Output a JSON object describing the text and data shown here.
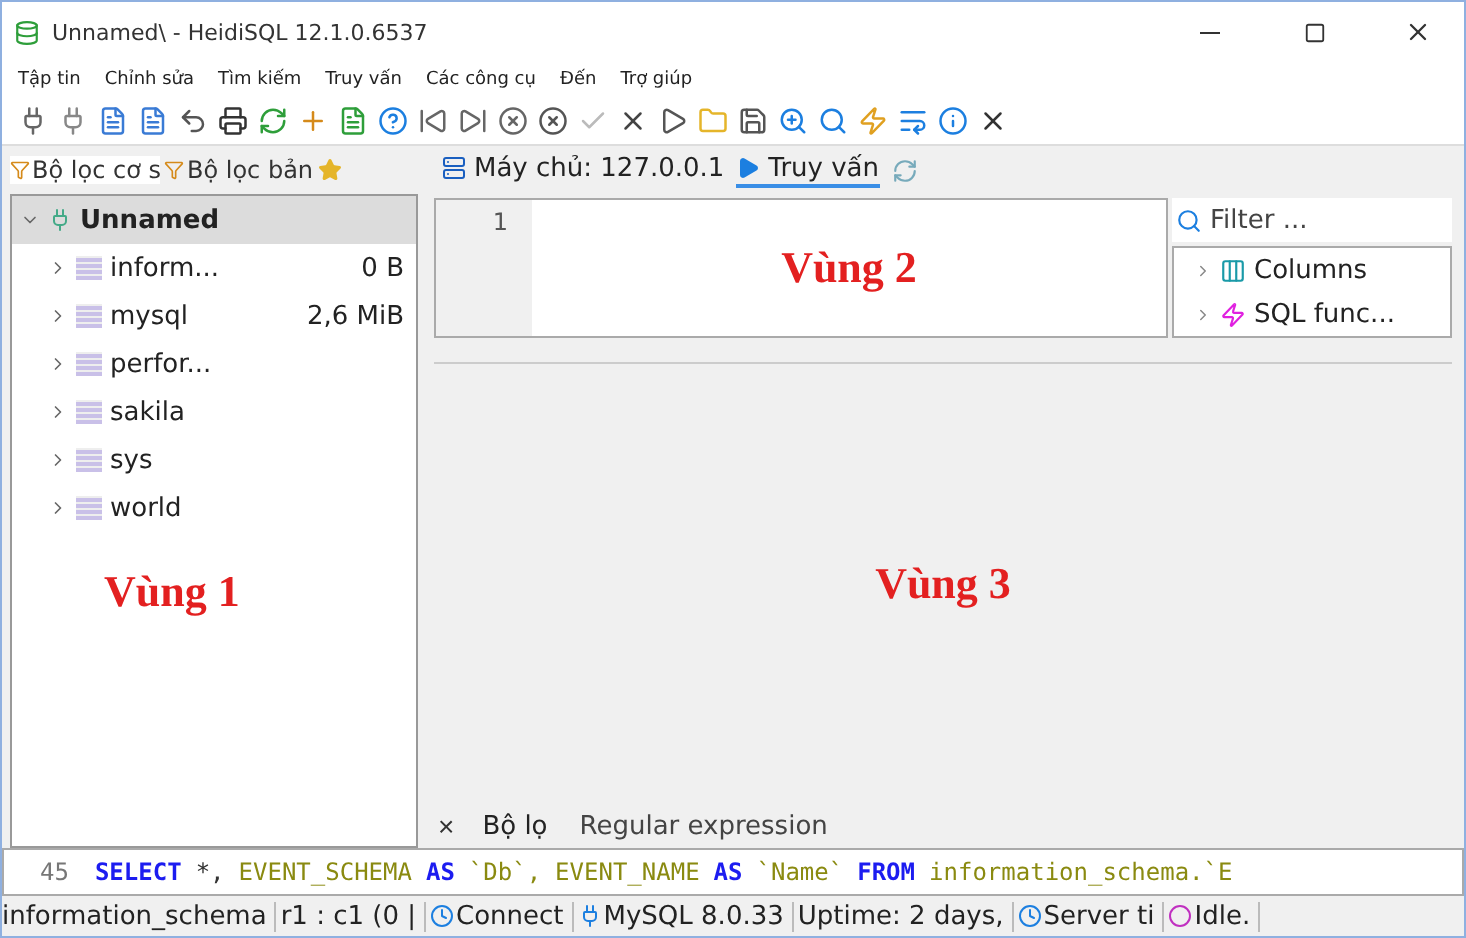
{
  "window": {
    "title": "Unnamed\\ - HeidiSQL 12.1.0.6537"
  },
  "menu": [
    "Tập tin",
    "Chỉnh sửa",
    "Tìm kiếm",
    "Truy vấn",
    "Các công cụ",
    "Đến",
    "Trợ giúp"
  ],
  "left_tabs": [
    {
      "label": "Bộ lọc cơ s",
      "selected": true
    },
    {
      "label": "Bộ lọc bản",
      "selected": false
    }
  ],
  "tree": {
    "label": "Unnamed",
    "expanded": true,
    "selected": true,
    "children": [
      {
        "label": "inform...",
        "size": "0 B",
        "expanded": false
      },
      {
        "label": "mysql",
        "size": "2,6 MiB",
        "expanded": false
      },
      {
        "label": "perfor...",
        "expanded": false
      },
      {
        "label": "sakila",
        "expanded": false
      },
      {
        "label": "sys",
        "expanded": false
      },
      {
        "label": "world",
        "expanded": false
      }
    ]
  },
  "host_tabs": [
    {
      "label": "Máy chủ: 127.0.0.1",
      "kind": "host",
      "selected": false
    },
    {
      "label": "Truy vấn",
      "kind": "query",
      "selected": true
    }
  ],
  "editor": {
    "line_numbers": [
      "1"
    ]
  },
  "helper": {
    "placeholder": "Filter ...",
    "items": [
      {
        "label": "Columns",
        "kind": "columns"
      },
      {
        "label": "SQL func...",
        "kind": "functions"
      }
    ]
  },
  "regions": [
    "Vùng 1",
    "Vùng 2",
    "Vùng 3"
  ],
  "filter_bar": {
    "close": "×",
    "label": "Bộ lọ",
    "placeholder": "Regular expression"
  },
  "log": {
    "line": "45",
    "tokens": [
      {
        "text": "SELECT",
        "kind": "keyword"
      },
      {
        "text": "*,",
        "kind": "plain"
      },
      {
        "text": "EVENT_SCHEMA",
        "kind": "ident"
      },
      {
        "text": "AS",
        "kind": "keyword"
      },
      {
        "text": "`Db`,",
        "kind": "ident"
      },
      {
        "text": "EVENT_NAME",
        "kind": "ident"
      },
      {
        "text": "AS",
        "kind": "keyword"
      },
      {
        "text": "`Name`",
        "kind": "ident"
      },
      {
        "text": "FROM",
        "kind": "keyword"
      },
      {
        "text": "information_schema.`E",
        "kind": "ident"
      }
    ]
  },
  "status_bar": [
    {
      "text": "information_schema",
      "kind": "text"
    },
    {
      "text": "r1 : c1 (0 |",
      "kind": "text"
    },
    {
      "text": "Connect",
      "kind": "clock"
    },
    {
      "text": "MySQL 8.0.33",
      "kind": "plug"
    },
    {
      "text": "Uptime: 2 days,",
      "kind": "text"
    },
    {
      "text": "Server ti",
      "kind": "clock"
    },
    {
      "text": "Idle.",
      "kind": "circle"
    }
  ]
}
